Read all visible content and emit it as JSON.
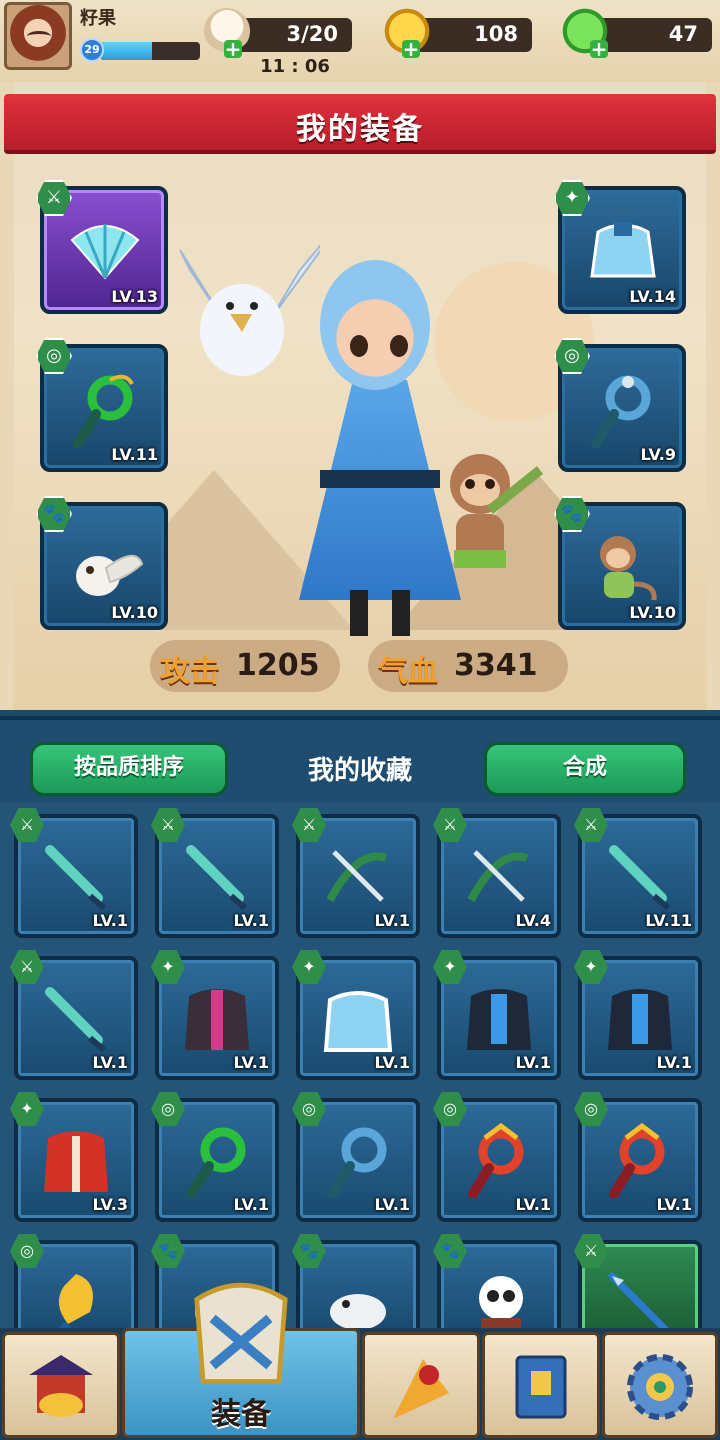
{
  "player": {
    "name": "籽果",
    "level": "29",
    "xp_fraction": 0.52
  },
  "resources": {
    "stamina": {
      "value": "3/20",
      "icon": "bun-icon"
    },
    "gold_leaf": {
      "value": "108",
      "icon": "gold-leaf-icon"
    },
    "green_leaf": {
      "value": "47",
      "icon": "green-leaf-icon"
    }
  },
  "timer": "11 : 06",
  "equipment": {
    "title": "我的装备",
    "slots": [
      {
        "name": "fan",
        "level": "LV.13",
        "type": "sword-icon",
        "rarity": "purple"
      },
      {
        "name": "armor",
        "level": "LV.14",
        "type": "axe-icon",
        "rarity": "blue"
      },
      {
        "name": "jade-pendant-green",
        "level": "LV.11",
        "type": "ring-icon",
        "rarity": "blue"
      },
      {
        "name": "jade-pendant-blue",
        "level": "LV.9",
        "type": "ring-icon",
        "rarity": "blue"
      },
      {
        "name": "owl-pet",
        "level": "LV.10",
        "type": "paw-icon",
        "rarity": "blue"
      },
      {
        "name": "monkey-pet",
        "level": "LV.10",
        "type": "paw-icon",
        "rarity": "blue"
      }
    ],
    "stats": {
      "attack_label": "攻击",
      "attack_value": "1205",
      "hp_label": "气血",
      "hp_value": "3341"
    }
  },
  "collection": {
    "title": "我的收藏",
    "sort_button": "按品质排序",
    "craft_button": "合成",
    "items": [
      {
        "art": "dagger",
        "level": "LV.1",
        "type": "sword"
      },
      {
        "art": "dagger",
        "level": "LV.1",
        "type": "sword"
      },
      {
        "art": "crossbow",
        "level": "LV.1",
        "type": "sword"
      },
      {
        "art": "crossbow",
        "level": "LV.4",
        "type": "sword"
      },
      {
        "art": "dagger",
        "level": "LV.11",
        "type": "sword"
      },
      {
        "art": "dagger",
        "level": "LV.1",
        "type": "sword"
      },
      {
        "art": "robe-dark",
        "level": "LV.1",
        "type": "axe"
      },
      {
        "art": "robe-snow",
        "level": "LV.1",
        "type": "axe"
      },
      {
        "art": "robe-blue",
        "level": "LV.1",
        "type": "axe"
      },
      {
        "art": "robe-blue",
        "level": "LV.1",
        "type": "axe"
      },
      {
        "art": "robe-red",
        "level": "LV.3",
        "type": "axe"
      },
      {
        "art": "pendant-green",
        "level": "LV.1",
        "type": "ring"
      },
      {
        "art": "pendant-blue",
        "level": "LV.1",
        "type": "ring"
      },
      {
        "art": "pendant-red",
        "level": "LV.1",
        "type": "ring"
      },
      {
        "art": "pendant-red",
        "level": "LV.1",
        "type": "ring"
      },
      {
        "art": "pendant-gold",
        "level": "",
        "type": "ring"
      },
      {
        "art": "pet-owl",
        "level": "",
        "type": "paw"
      },
      {
        "art": "pet-ferret",
        "level": "",
        "type": "paw"
      },
      {
        "art": "pet-panda",
        "level": "",
        "type": "paw"
      },
      {
        "art": "spear",
        "level": "",
        "type": "sword",
        "rarity": "green"
      }
    ]
  },
  "nav": {
    "tabs": [
      {
        "id": "shop",
        "label": "",
        "icon": "shop-icon"
      },
      {
        "id": "equipment",
        "label": "装备",
        "icon": "armor-icon",
        "active": true
      },
      {
        "id": "battle",
        "label": "",
        "icon": "battle-icon"
      },
      {
        "id": "book",
        "label": "",
        "icon": "book-icon"
      },
      {
        "id": "settings",
        "label": "",
        "icon": "settings-icon"
      }
    ]
  }
}
